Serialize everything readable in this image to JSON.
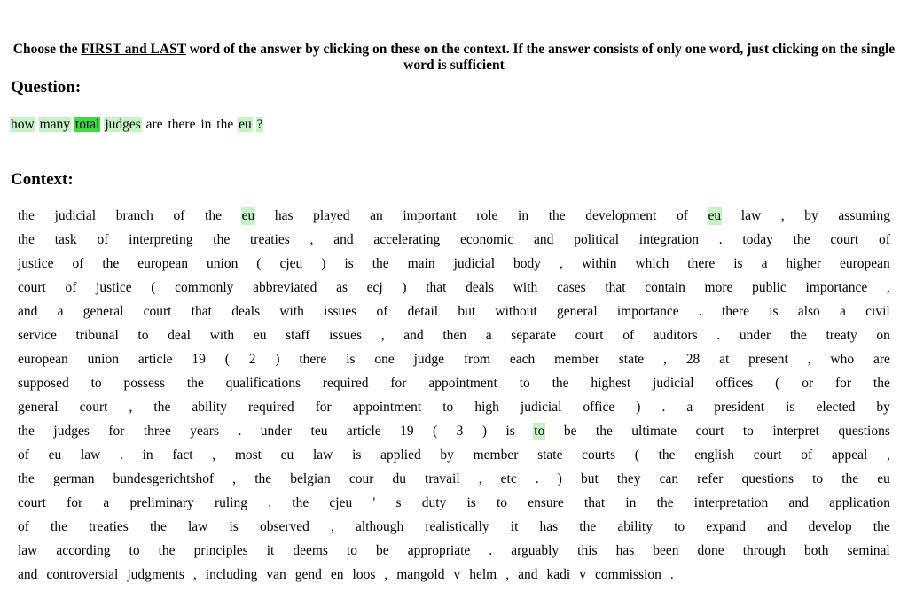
{
  "instructions": {
    "before": "Choose the ",
    "underlined": "FIRST and LAST",
    "after": " word of the answer by clicking on these on the context. If the answer consists of only one word, just clicking on the single word is sufficient"
  },
  "question_heading": "Question:",
  "question_words": [
    {
      "text": "how",
      "hl": "light"
    },
    {
      "text": "many",
      "hl": "light"
    },
    {
      "text": "total",
      "hl": "strong"
    },
    {
      "text": "judges",
      "hl": "light"
    },
    {
      "text": "are",
      "hl": ""
    },
    {
      "text": "there",
      "hl": ""
    },
    {
      "text": "in",
      "hl": ""
    },
    {
      "text": "the",
      "hl": ""
    },
    {
      "text": "eu",
      "hl": "light"
    },
    {
      "text": "?",
      "hl": "light"
    }
  ],
  "context_heading": "Context:",
  "context_lines": [
    "the judicial branch of the eu has played an important role in the development of eu law , by assuming",
    "the task of interpreting the treaties , and accelerating economic and political integration . today the court of",
    "justice of the european union ( cjeu ) is the main judicial body , within which there is a higher european",
    "court of justice ( commonly abbreviated as ecj ) that deals with cases that contain more public importance ,",
    "and a general court that deals with issues of detail but without general importance . there is also a civil",
    "service tribunal to deal with eu staff issues , and then a separate court of auditors . under the treaty on",
    "european union article 19 ( 2 ) there is one judge from each member state , 28 at present , who are",
    "supposed to possess the qualifications required for appointment to the highest judicial offices ( or for the",
    "general court , the ability required for appointment to high judicial office ) . a president is elected by",
    "the judges for three years . under teu article 19 ( 3 ) is to be the ultimate court to interpret questions",
    "of eu law . in fact , most eu law is applied by member state courts ( the english court of appeal ,",
    "the german bundesgerichtshof , the belgian cour du travail , etc . ) but they can refer questions to the eu",
    "court for a preliminary ruling . the cjeu ' s duty is to ensure that in the interpretation and application",
    "of the treaties the law is observed , although realistically it has the ability to expand and develop the",
    "law according to the principles it deems to be appropriate . arguably this has been done through both seminal",
    "and controversial judgments , including van gend en loos , mangold v helm , and kadi v commission ."
  ],
  "highlights": [
    {
      "line": 0,
      "word": 5
    },
    {
      "line": 0,
      "word": 15
    },
    {
      "line": 9,
      "word": 14
    }
  ]
}
